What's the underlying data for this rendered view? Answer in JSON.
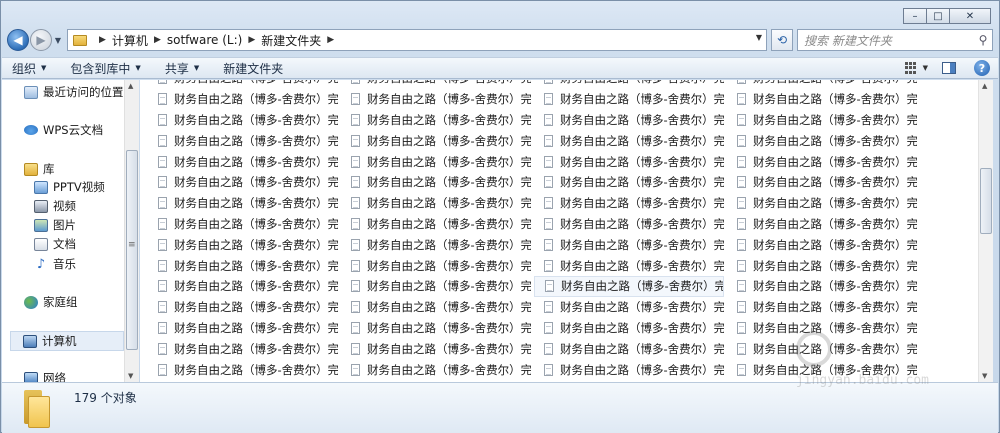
{
  "window": {
    "minimize_symbol": "–",
    "maximize_symbol": "□",
    "close_symbol": "✕"
  },
  "address_bar": {
    "breadcrumbs": [
      "计算机",
      "sotfware (L:)",
      "新建文件夹"
    ],
    "search_placeholder": "搜索 新建文件夹"
  },
  "toolbar": {
    "organize": "组织",
    "include_in_library": "包含到库中",
    "share": "共享",
    "new_folder": "新建文件夹"
  },
  "navigation": {
    "items": [
      {
        "label": "最近访问的位置",
        "icon": "recent-places-icon"
      },
      {
        "label": "WPS云文档",
        "icon": "cloud-icon"
      },
      {
        "label": "库",
        "icon": "library-icon"
      },
      {
        "label": "PPTV视频",
        "icon": "pptv-icon"
      },
      {
        "label": "视频",
        "icon": "video-icon"
      },
      {
        "label": "图片",
        "icon": "pictures-icon"
      },
      {
        "label": "文档",
        "icon": "documents-icon"
      },
      {
        "label": "音乐",
        "icon": "music-icon"
      },
      {
        "label": "家庭组",
        "icon": "homegroup-icon"
      },
      {
        "label": "计算机",
        "icon": "computer-icon"
      },
      {
        "label": "网络",
        "icon": "network-icon"
      }
    ]
  },
  "files": {
    "item_name": "财务自由之路（博多-舍费尔）完...",
    "columns": [
      [
        "财务自由之路（博多-舍费尔）完...",
        "财务自由之路（博多-舍费尔）完...",
        "财务自由之路（博多-舍费尔）完...",
        "财务自由之路（博多-舍费尔）完...",
        "财务自由之路（博多-舍费尔）完...",
        "财务自由之路（博多-舍费尔）完...",
        "财务自由之路（博多-舍费尔）完...",
        "财务自由之路（博多-舍费尔）完...",
        "财务自由之路（博多-舍费尔）完...",
        "财务自由之路（博多-舍费尔）完...",
        "财务自由之路（博多-舍费尔）完...",
        "财务自由之路（博多-舍费尔）完...",
        "财务自由之路（博多-舍费尔）完...",
        "财务自由之路（博多-舍费尔）完...",
        "财务自由之路（博多-舍费尔）完..."
      ],
      [
        "财务自由之路（博多-舍费尔）完...",
        "财务自由之路（博多-舍费尔）完...",
        "财务自由之路（博多-舍费尔）完...",
        "财务自由之路（博多-舍费尔）完...",
        "财务自由之路（博多-舍费尔）完...",
        "财务自由之路（博多-舍费尔）完...",
        "财务自由之路（博多-舍费尔）完...",
        "财务自由之路（博多-舍费尔）完...",
        "财务自由之路（博多-舍费尔）完...",
        "财务自由之路（博多-舍费尔）完...",
        "财务自由之路（博多-舍费尔）完...",
        "财务自由之路（博多-舍费尔）完...",
        "财务自由之路（博多-舍费尔）完...",
        "财务自由之路（博多-舍费尔）完...",
        "财务自由之路（博多-舍费尔）完..."
      ],
      [
        "财务自由之路（博多-舍费尔）完...",
        "财务自由之路（博多-舍费尔）完...",
        "财务自由之路（博多-舍费尔）完...",
        "财务自由之路（博多-舍费尔）完...",
        "财务自由之路（博多-舍费尔）完...",
        "财务自由之路（博多-舍费尔）完...",
        "财务自由之路（博多-舍费尔）完...",
        "财务自由之路（博多-舍费尔）完...",
        "财务自由之路（博多-舍费尔）完...",
        "财务自由之路（博多-舍费尔）完...",
        "财务自由之路（博多-舍费尔）完...",
        "财务自由之路（博多-舍费尔）完...",
        "财务自由之路（博多-舍费尔）完...",
        "财务自由之路（博多-舍费尔）完...",
        "财务自由之路（博多-舍费尔）完..."
      ],
      [
        "财务自由之路（博多-舍费尔）完...",
        "财务自由之路（博多-舍费尔）完...",
        "财务自由之路（博多-舍费尔）完...",
        "财务自由之路（博多-舍费尔）完...",
        "财务自由之路（博多-舍费尔）完...",
        "财务自由之路（博多-舍费尔）完...",
        "财务自由之路（博多-舍费尔）完...",
        "财务自由之路（博多-舍费尔）完...",
        "财务自由之路（博多-舍费尔）完...",
        "财务自由之路（博多-舍费尔）完...",
        "财务自由之路（博多-舍费尔）完...",
        "财务自由之路（博多-舍费尔）完...",
        "财务自由之路（博多-舍费尔）完...",
        "财务自由之路（博多-舍费尔）完...",
        "财务自由之路（博多-舍费尔）完..."
      ]
    ]
  },
  "status": {
    "object_count": "179 个对象"
  },
  "watermark": {
    "url": "jingyan.baidu.com"
  }
}
